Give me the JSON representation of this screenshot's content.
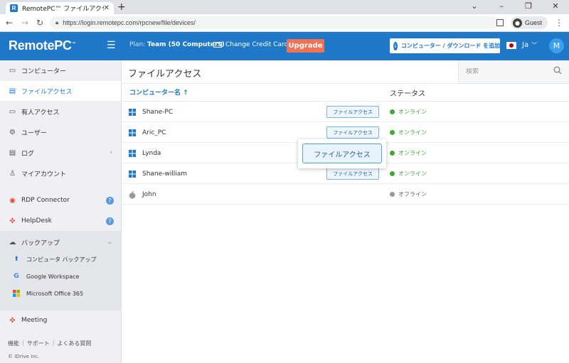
{
  "browser": {
    "tab_title": "RemotePC™ ファイルアクセス",
    "url": "https://login.remotepc.com/rpcnew/file/devices/",
    "profile_label": "Guest"
  },
  "header": {
    "logo": "RemotePC",
    "logo_tm": "™",
    "plan_prefix": "Plan: ",
    "plan_value": "Team (50 Computers)",
    "change_card": "Change Credit Card",
    "upgrade": "Upgrade",
    "download": "コンピューター / ダウンロード を追加",
    "language": "Ja",
    "avatar_initial": "M",
    "brand_color": "#1f78c8",
    "upgrade_color": "#f07154"
  },
  "sidebar": {
    "items": [
      {
        "label": "コンピューター",
        "icon": "monitor-icon"
      },
      {
        "label": "ファイルアクセス",
        "icon": "file-drive-icon"
      },
      {
        "label": "有人アクセス",
        "icon": "attended-access-icon"
      },
      {
        "label": "ユーザー",
        "icon": "user-settings-icon"
      },
      {
        "label": "ログ",
        "icon": "log-icon"
      },
      {
        "label": "マイアカウント",
        "icon": "account-icon"
      },
      {
        "label": "RDP Connector",
        "icon": "rdp-connector-icon"
      },
      {
        "label": "HelpDesk",
        "icon": "helpdesk-icon"
      },
      {
        "label": "バックアップ",
        "icon": "cloud-backup-icon"
      }
    ],
    "backup_sub": [
      {
        "label": "コンピュータ バックアップ",
        "icon": "computer-backup-icon"
      },
      {
        "label": "Google Workspace",
        "icon": "google-icon"
      },
      {
        "label": "Microsoft Office 365",
        "icon": "office365-icon"
      }
    ],
    "meeting": "Meeting",
    "footer": [
      "機能",
      "サポート",
      "よくある質問"
    ],
    "copyright": "© IDrive Inc."
  },
  "main": {
    "title": "ファイルアクセス",
    "search_placeholder": "検索",
    "col_name": "コンピューター名 ↑",
    "col_status": "ステータス",
    "file_access_label": "ファイルアクセス",
    "rows": [
      {
        "name": "Shane-PC",
        "os": "windows",
        "status": "オンライン",
        "online": true
      },
      {
        "name": "Aric_PC",
        "os": "windows",
        "status": "オンライン",
        "online": true
      },
      {
        "name": "Lynda",
        "os": "windows",
        "status": "オンライン",
        "online": true
      },
      {
        "name": "Shane-william",
        "os": "windows",
        "status": "オンライン",
        "online": true
      },
      {
        "name": "John",
        "os": "mac",
        "status": "オフライン",
        "online": false
      }
    ],
    "popover_label": "ファイルアクセス"
  }
}
